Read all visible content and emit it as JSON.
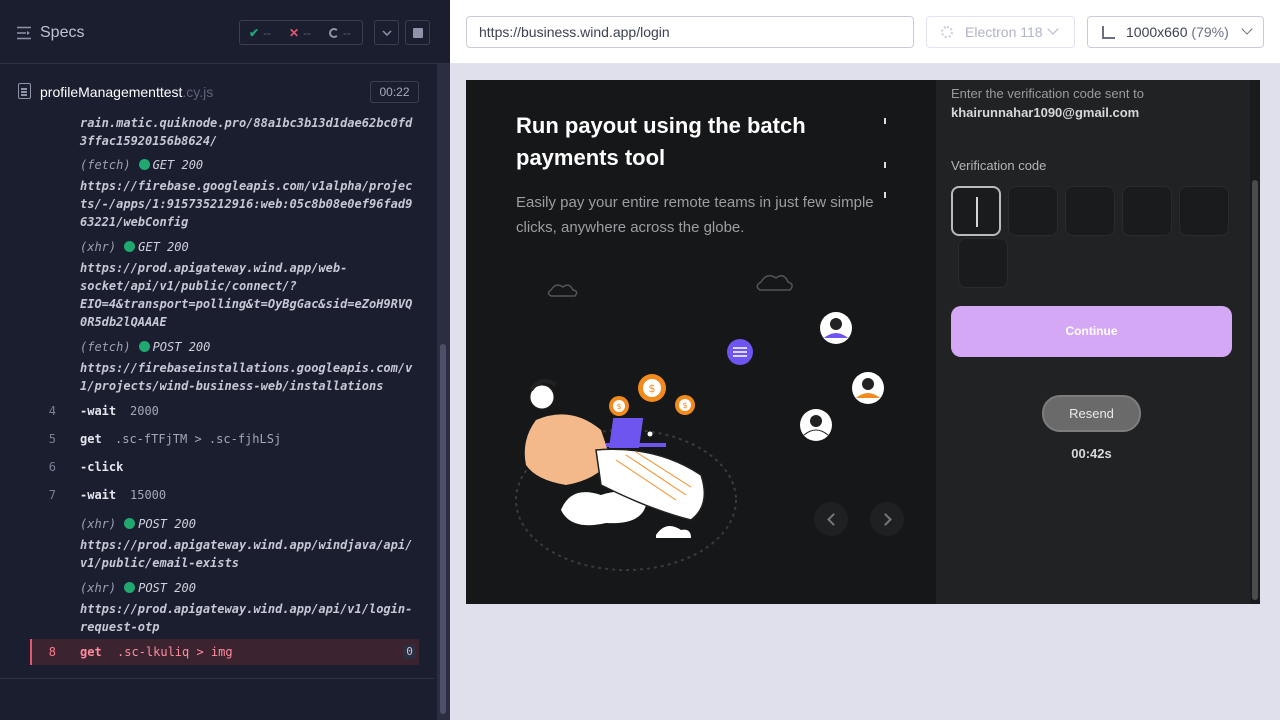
{
  "runner": {
    "title": "Specs",
    "passed": "--",
    "failed": "--",
    "pending": "--",
    "spec_name": "profileManagementtest",
    "spec_ext": ".cy.js",
    "duration": "00:22"
  },
  "log": {
    "top_url": "rain.matic.quiknode.pro/88a1bc3b13d1dae62bc0fd\n3ffac15920156b8624/",
    "requests": [
      {
        "kind": "(fetch)",
        "method": "GET 200",
        "url": "https://firebase.googleapis.com/v1alpha/projec\nts/-/apps/1:915735212916:web:05c8b08e0ef96fad9\n63221/webConfig"
      },
      {
        "kind": "(xhr)",
        "method": "GET 200",
        "url": "https://prod.apigateway.wind.app/web-\nsocket/api/v1/public/connect/?\nEIO=4&transport=polling&t=OyBgGac&sid=eZoH9RVQ\n0R5db2lQAAAE"
      },
      {
        "kind": "(fetch)",
        "method": "POST 200",
        "url": "https://firebaseinstallations.googleapis.com/v\n1/projects/wind-business-web/installations"
      },
      {
        "kind": "(xhr)",
        "method": "POST 200",
        "url": "https://prod.apigateway.wind.app/windjava/api/\nv1/public/email-exists"
      },
      {
        "kind": "(xhr)",
        "method": "POST 200",
        "url": "https://prod.apigateway.wind.app/api/v1/login-\nrequest-otp"
      }
    ],
    "commands": [
      {
        "num": "4",
        "name": "-wait",
        "arg": "2000"
      },
      {
        "num": "5",
        "name": "get",
        "arg": ".sc-fTFjTM > .sc-fjhLSj"
      },
      {
        "num": "6",
        "name": "-click",
        "arg": ""
      },
      {
        "num": "7",
        "name": "-wait",
        "arg": "15000"
      },
      {
        "num": "8",
        "name": "get",
        "arg": ".sc-lkuliq > img",
        "count": "0"
      }
    ]
  },
  "toolbar": {
    "url": "https://business.wind.app/login",
    "browser": "Electron 118",
    "viewport": "1000x660",
    "zoom": "(79%)"
  },
  "app": {
    "headline": "Run payout using the batch payments tool",
    "subtext": "Easily pay your entire remote teams in just few simple clicks, anywhere across the globe.",
    "info_prefix": "Enter the verification code sent to",
    "email": "khairunnahar1090@gmail.com",
    "code_label": "Verification code",
    "continue_label": "Continue",
    "resend_label": "Resend",
    "timer": "00:42s"
  },
  "colors": {
    "runner_bg": "#1b1e2e",
    "pass": "#1fa971",
    "fail": "#e45770",
    "continue_button": "#d5a8f6"
  }
}
